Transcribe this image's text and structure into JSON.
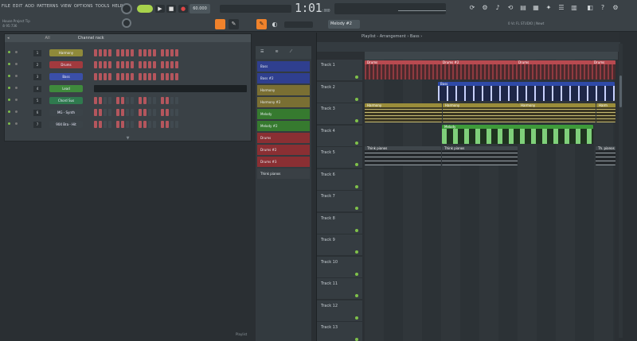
{
  "menu": [
    "FILE",
    "EDIT",
    "ADD",
    "PATTERNS",
    "VIEW",
    "OPTIONS",
    "TOOLS",
    "HELP"
  ],
  "song": {
    "name": "House Project Tip",
    "info": "⏱ 95:736"
  },
  "transport": {
    "tempo": "60.000",
    "time": "1:01",
    "time_sub": ":000",
    "pattern": "Melody #2"
  },
  "hint_text": "0 Vc FL STUDIO | Newt",
  "channel_rack": {
    "title": "Channel rack",
    "filter": "All",
    "footer": "▼",
    "channels": [
      {
        "num": "1",
        "name": "Harmony",
        "color": "#8f8a3a"
      },
      {
        "num": "2",
        "name": "Drums",
        "color": "#a13a3e"
      },
      {
        "num": "3",
        "name": "Bass",
        "color": "#3a4fa8"
      },
      {
        "num": "4",
        "name": "Lead",
        "color": "#3f8a3c"
      },
      {
        "num": "5",
        "name": "Chord Sus",
        "color": "#2f7a4e"
      },
      {
        "num": "6",
        "name": "MG - Synth",
        "color": "#3b4348"
      },
      {
        "num": "7",
        "name": "904 Bra - Hit",
        "color": "#3b4348"
      }
    ]
  },
  "browser": {
    "tabs": [
      "☰",
      "≋",
      "⟋"
    ],
    "clips": [
      {
        "name": "Bass",
        "color": "#2f3f8f"
      },
      {
        "name": "Bass #2",
        "color": "#2f3f8f"
      },
      {
        "name": "Harmony",
        "color": "#7a6f33"
      },
      {
        "name": "Harmony #2",
        "color": "#7a6f33"
      },
      {
        "name": "Melody",
        "color": "#367a2f"
      },
      {
        "name": "Melody #2",
        "color": "#367a2f"
      },
      {
        "name": "Drums",
        "color": "#8a2f33"
      },
      {
        "name": "Drums #2",
        "color": "#8a2f33"
      },
      {
        "name": "Drums #3",
        "color": "#8a2f33"
      },
      {
        "name": "Think pianos",
        "color": "#3a4045"
      }
    ]
  },
  "playlist": {
    "title": "Playlist - Arrangement › Bass ›",
    "bottom_hint": "Playlist",
    "tracks": [
      "Track 1",
      "Track 2",
      "Track 3",
      "Track 4",
      "Track 5",
      "Track 6",
      "Track 7",
      "Track 8",
      "Track 9",
      "Track 10",
      "Track 11",
      "Track 12",
      "Track 13"
    ],
    "clips": {
      "drums": [
        "Drums",
        "Drums #2",
        "Drums",
        "Drums"
      ],
      "bass": "Bass",
      "harmony": [
        "Harmony",
        "Harmony",
        "Harmony",
        "Harm"
      ],
      "melody": "Melody",
      "pianos": [
        "Think pianos",
        "Think pianos",
        "Th. pianos"
      ]
    }
  },
  "colors": {
    "accent": "#f0822b",
    "step_on": "#b4565d",
    "green": "#7fc14a"
  }
}
